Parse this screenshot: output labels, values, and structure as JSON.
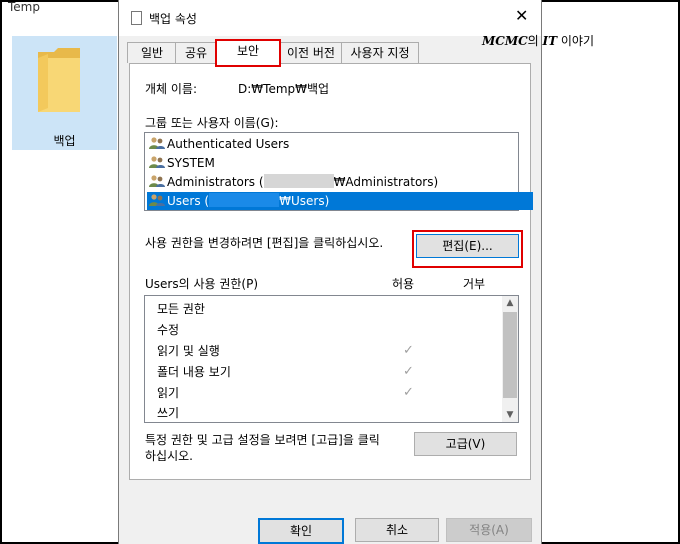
{
  "explorer": {
    "title": "Temp",
    "folder_label": "백업"
  },
  "watermark": {
    "brand": "MCMC",
    "mid": "의 ",
    "it": "IT",
    "tail": " 이야기"
  },
  "dialog": {
    "title": "백업 속성",
    "tabs": [
      {
        "label": "일반"
      },
      {
        "label": "공유"
      },
      {
        "label": "보안",
        "active": true
      },
      {
        "label": "이전 버전"
      },
      {
        "label": "사용자 지정"
      }
    ],
    "object_name_label": "개체 이름:",
    "object_name_value": "D:₩Temp₩백업",
    "group_label": "그룹 또는 사용자 이름(G):",
    "users": [
      {
        "name": "Authenticated Users"
      },
      {
        "name": "SYSTEM"
      },
      {
        "name_pre": "Administrators (",
        "name_post": "₩Administrators)"
      },
      {
        "name_pre": "Users (",
        "name_post": "₩Users)",
        "selected": true
      }
    ],
    "change_hint": "사용 권한을 변경하려면 [편집]을 클릭하십시오.",
    "edit_button": "편집(E)...",
    "permissions_label": "Users의 사용 권한(P)",
    "allow_header": "허용",
    "deny_header": "거부",
    "permissions": [
      {
        "name": "모든 권한",
        "allow": false
      },
      {
        "name": "수정",
        "allow": false
      },
      {
        "name": "읽기 및 실행",
        "allow": true
      },
      {
        "name": "폴더 내용 보기",
        "allow": true
      },
      {
        "name": "읽기",
        "allow": true
      },
      {
        "name": "쓰기",
        "allow": false
      }
    ],
    "advanced_hint_line1": "특정 권한 및 고급 설정을 보려면 [고급]을 클릭",
    "advanced_hint_line2": "하십시오.",
    "advanced_button": "고급(V)",
    "ok_button": "확인",
    "cancel_button": "취소",
    "apply_button": "적용(A)"
  },
  "colors": {
    "selection": "#0078d7",
    "highlight_box": "#e00000",
    "folder_tile": "#cce4f7",
    "folder_yellow": "#f8d775"
  }
}
